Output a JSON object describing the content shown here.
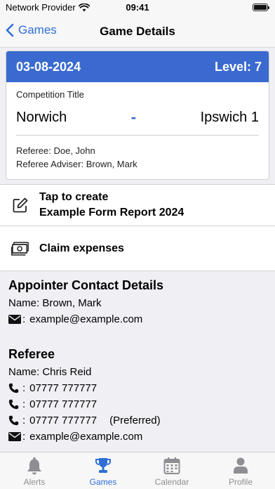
{
  "status_bar": {
    "carrier": "Network Provider",
    "time": "09:41"
  },
  "nav": {
    "back_label": "Games",
    "title": "Game Details"
  },
  "game": {
    "date": "03-08-2024",
    "level": "Level: 7",
    "competition_title": "Competition Title",
    "home_team": "Norwich",
    "separator": "-",
    "away_team": "Ipswich 1",
    "referee": "Referee: Doe, John",
    "referee_adviser": "Referee Adviser: Brown, Mark"
  },
  "actions": {
    "report_line1": "Tap to create",
    "report_line2": "Example Form Report 2024",
    "claim_expenses": "Claim expenses"
  },
  "appointer": {
    "title": "Appointer Contact Details",
    "name": "Name: Brown, Mark",
    "email": "example@example.com"
  },
  "referee": {
    "title": "Referee",
    "name": "Name: Chris Reid",
    "phones": [
      "07777 777777",
      "07777 777777",
      "07777 777777"
    ],
    "preferred": "(Preferred)",
    "email": "example@example.com"
  },
  "colon": ":",
  "tabs": [
    {
      "label": "Alerts",
      "icon": "bell-icon"
    },
    {
      "label": "Games",
      "icon": "trophy-icon",
      "active": true
    },
    {
      "label": "Calendar",
      "icon": "calendar-icon"
    },
    {
      "label": "Profile",
      "icon": "person-icon"
    }
  ],
  "colors": {
    "accent": "#3a6ad0",
    "tab_active": "#2f6fd6",
    "tab_inactive": "#8e8e93"
  }
}
